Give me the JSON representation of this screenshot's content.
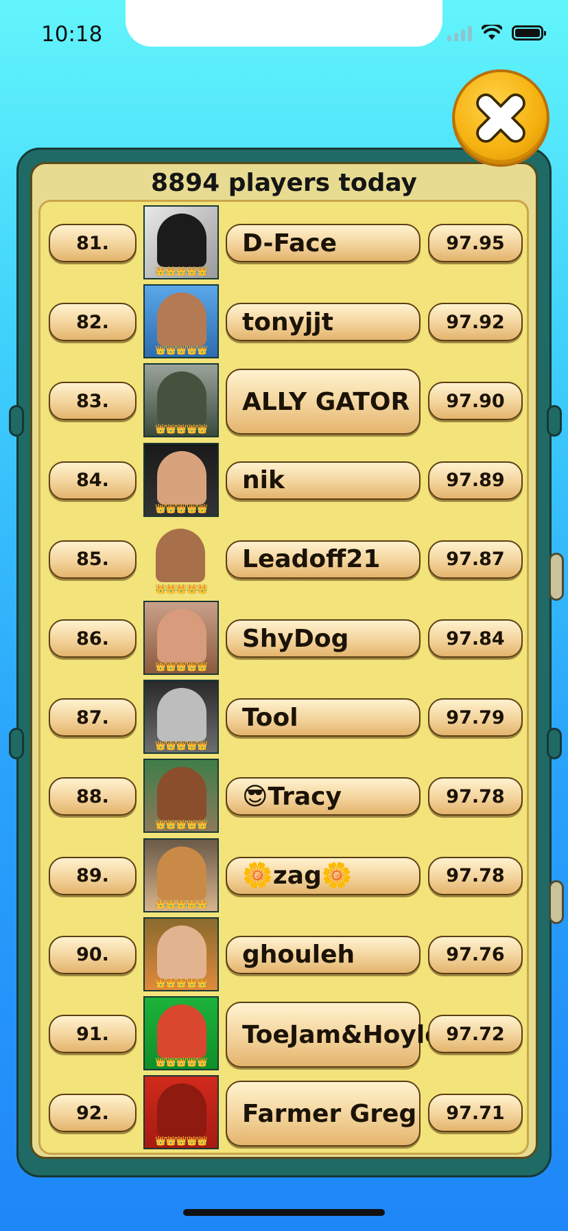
{
  "status_bar": {
    "time": "10:18"
  },
  "leaderboard": {
    "title": "8894 players today",
    "rows": [
      {
        "rank": "81.",
        "name": "D-Face",
        "score": "97.95",
        "avatar": "cat-photo",
        "crowns": "👑👑👑👑👑"
      },
      {
        "rank": "82.",
        "name": "tonyjjt",
        "score": "97.92",
        "avatar": "man-with-cap-photo",
        "crowns": "👑👑👑👑👑"
      },
      {
        "rank": "83.",
        "name": "ALLY GATOR",
        "score": "97.90",
        "avatar": "alligator-photo",
        "crowns": "👑👑👑👑👑"
      },
      {
        "rank": "84.",
        "name": "nik",
        "score": "97.89",
        "avatar": "woman-photo",
        "crowns": "👑👑👑👑👑"
      },
      {
        "rank": "85.",
        "name": "Leadoff21",
        "score": "97.87",
        "avatar": "man-portrait",
        "crowns": "👑👑👑👑👑"
      },
      {
        "rank": "86.",
        "name": "ShyDog",
        "score": "97.84",
        "avatar": "man-selfie-photo",
        "crowns": "👑👑👑👑👑"
      },
      {
        "rank": "87.",
        "name": "Tool",
        "score": "97.79",
        "avatar": "alien-art",
        "crowns": "👑👑👑👑👑"
      },
      {
        "rank": "88.",
        "name": "😎Tracy",
        "score": "97.78",
        "avatar": "woman-sunglasses-photo",
        "crowns": "👑👑👑👑👑"
      },
      {
        "rank": "89.",
        "name": "🌼zag🌼",
        "score": "97.78",
        "avatar": "dog-photo",
        "crowns": "👑👑👑👑👑"
      },
      {
        "rank": "90.",
        "name": "ghouleh",
        "score": "97.76",
        "avatar": "man-photo",
        "crowns": "👑👑👑👑👑"
      },
      {
        "rank": "91.",
        "name": "ToeJam&Hoyle",
        "score": "97.72",
        "avatar": "cartoon-characters",
        "crowns": "👑👑👑👑👑"
      },
      {
        "rank": "92.",
        "name": "Farmer Greg",
        "score": "97.71",
        "avatar": "red-cartoon-logo",
        "crowns": "👑👑👑👑👑"
      }
    ]
  },
  "colors": {
    "background_top": "#62f5fb",
    "background_bottom": "#1f86f8",
    "panel": "#1f6a64",
    "inner": "#e7db92",
    "list": "#f2e37a",
    "pill": "#f3d39b",
    "close_button": "#f6b311"
  },
  "icons": {
    "close": "close-x-icon",
    "wifi": "wifi-icon",
    "signal": "signal-bars-icon",
    "battery": "battery-icon",
    "crown": "crown-icon"
  }
}
